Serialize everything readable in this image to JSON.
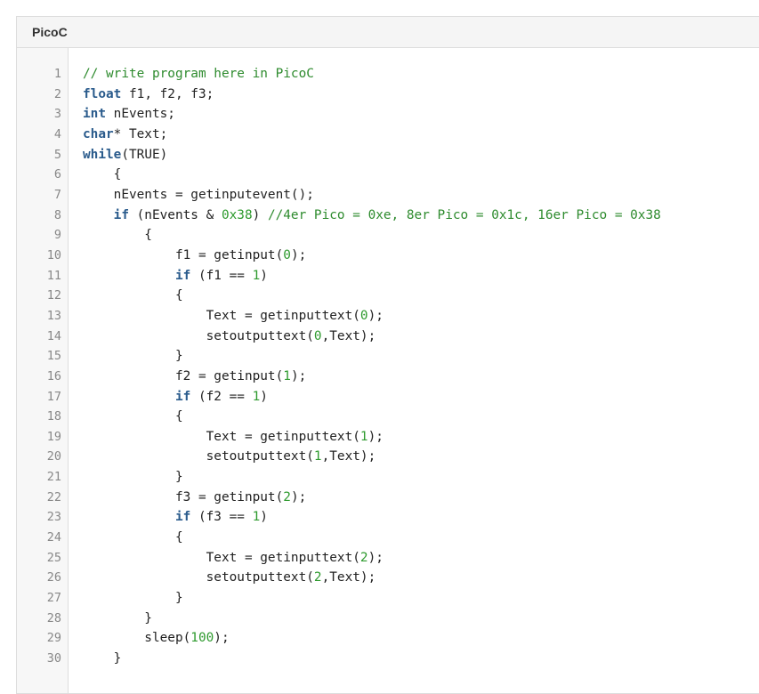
{
  "panel": {
    "title": "PicoC"
  },
  "colors": {
    "keyword": "#2a5b8c",
    "comment": "#2e8b2e",
    "number": "#2e9a2e"
  },
  "code": [
    [
      [
        "cm",
        "// write program here in PicoC"
      ]
    ],
    [
      [
        "kw",
        "float"
      ],
      [
        "tx",
        " f1, f2, f3;"
      ]
    ],
    [
      [
        "kw",
        "int"
      ],
      [
        "tx",
        " nEvents;"
      ]
    ],
    [
      [
        "kw",
        "char"
      ],
      [
        "tx",
        "* Text;"
      ]
    ],
    [
      [
        "kw",
        "while"
      ],
      [
        "tx",
        "(TRUE)"
      ]
    ],
    [
      [
        "tx",
        "    {"
      ]
    ],
    [
      [
        "tx",
        "    nEvents = getinputevent();"
      ]
    ],
    [
      [
        "tx",
        "    "
      ],
      [
        "kw",
        "if"
      ],
      [
        "tx",
        " (nEvents & "
      ],
      [
        "nm",
        "0x38"
      ],
      [
        "tx",
        ") "
      ],
      [
        "cm",
        "//4er Pico = 0xe, 8er Pico = 0x1c, 16er Pico = 0x38"
      ]
    ],
    [
      [
        "tx",
        "        {"
      ]
    ],
    [
      [
        "tx",
        "            f1 = getinput("
      ],
      [
        "nm",
        "0"
      ],
      [
        "tx",
        ");"
      ]
    ],
    [
      [
        "tx",
        "            "
      ],
      [
        "kw",
        "if"
      ],
      [
        "tx",
        " (f1 == "
      ],
      [
        "nm",
        "1"
      ],
      [
        "tx",
        ")"
      ]
    ],
    [
      [
        "tx",
        "            {"
      ]
    ],
    [
      [
        "tx",
        "                Text = getinputtext("
      ],
      [
        "nm",
        "0"
      ],
      [
        "tx",
        ");"
      ]
    ],
    [
      [
        "tx",
        "                setoutputtext("
      ],
      [
        "nm",
        "0"
      ],
      [
        "tx",
        ",Text);"
      ]
    ],
    [
      [
        "tx",
        "            }"
      ]
    ],
    [
      [
        "tx",
        "            f2 = getinput("
      ],
      [
        "nm",
        "1"
      ],
      [
        "tx",
        ");"
      ]
    ],
    [
      [
        "tx",
        "            "
      ],
      [
        "kw",
        "if"
      ],
      [
        "tx",
        " (f2 == "
      ],
      [
        "nm",
        "1"
      ],
      [
        "tx",
        ")"
      ]
    ],
    [
      [
        "tx",
        "            {"
      ]
    ],
    [
      [
        "tx",
        "                Text = getinputtext("
      ],
      [
        "nm",
        "1"
      ],
      [
        "tx",
        ");"
      ]
    ],
    [
      [
        "tx",
        "                setoutputtext("
      ],
      [
        "nm",
        "1"
      ],
      [
        "tx",
        ",Text);"
      ]
    ],
    [
      [
        "tx",
        "            }"
      ]
    ],
    [
      [
        "tx",
        "            f3 = getinput("
      ],
      [
        "nm",
        "2"
      ],
      [
        "tx",
        ");"
      ]
    ],
    [
      [
        "tx",
        "            "
      ],
      [
        "kw",
        "if"
      ],
      [
        "tx",
        " (f3 == "
      ],
      [
        "nm",
        "1"
      ],
      [
        "tx",
        ")"
      ]
    ],
    [
      [
        "tx",
        "            {"
      ]
    ],
    [
      [
        "tx",
        "                Text = getinputtext("
      ],
      [
        "nm",
        "2"
      ],
      [
        "tx",
        ");"
      ]
    ],
    [
      [
        "tx",
        "                setoutputtext("
      ],
      [
        "nm",
        "2"
      ],
      [
        "tx",
        ",Text);"
      ]
    ],
    [
      [
        "tx",
        "            }"
      ]
    ],
    [
      [
        "tx",
        "        }"
      ]
    ],
    [
      [
        "tx",
        "        sleep("
      ],
      [
        "nm",
        "100"
      ],
      [
        "tx",
        ");"
      ]
    ],
    [
      [
        "tx",
        "    }"
      ]
    ]
  ]
}
